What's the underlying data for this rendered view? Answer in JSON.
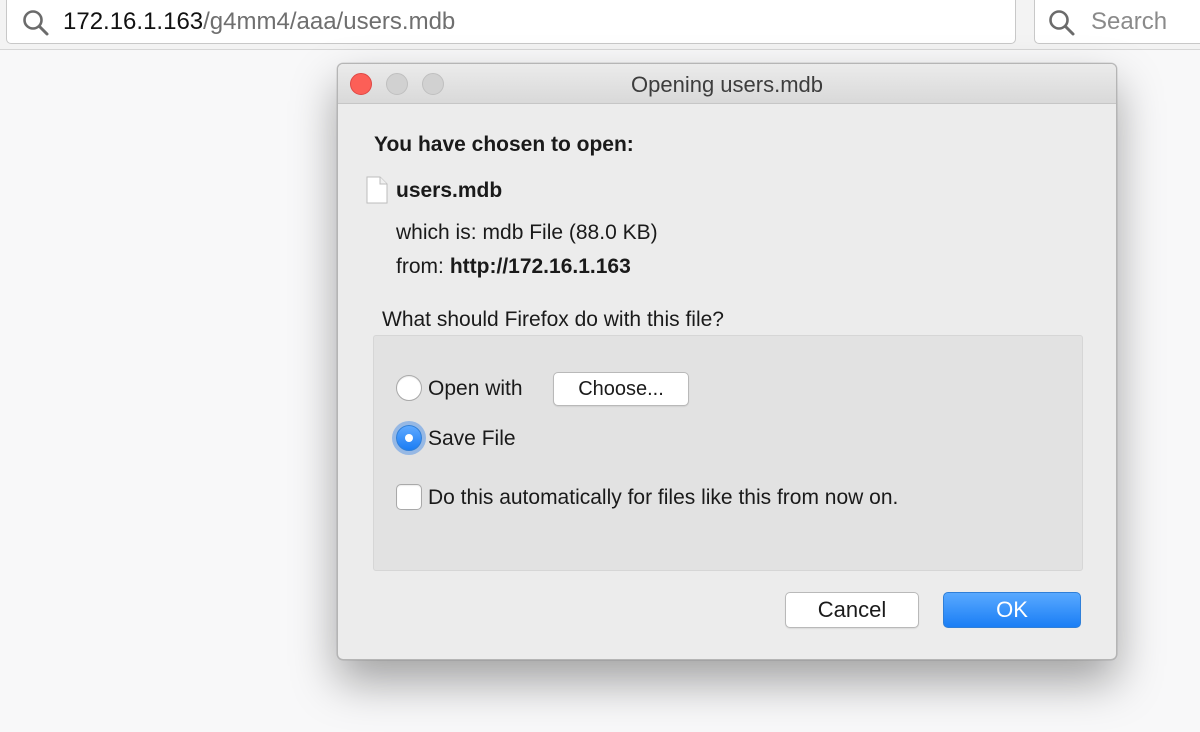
{
  "browser": {
    "url_host": "172.16.1.163",
    "url_path": "/g4mm4/aaa/users.mdb",
    "search_placeholder": "Search"
  },
  "dialog": {
    "title": "Opening users.mdb",
    "heading": "You have chosen to open:",
    "file_name": "users.mdb",
    "which_is_label": "which is:",
    "which_is_value": "mdb File (88.0 KB)",
    "from_label": "from:",
    "from_value": "http://172.16.1.163",
    "question": "What should Firefox do with this file?",
    "options": {
      "open_with_label": "Open with",
      "choose_label": "Choose...",
      "save_file_label": "Save File",
      "auto_label": "Do this automatically for files like this from now on."
    },
    "selected_option": "save_file",
    "auto_checked": false,
    "cancel_label": "Cancel",
    "ok_label": "OK"
  },
  "icons": {
    "url_icon": "search-icon",
    "search_icon": "search-icon",
    "file_icon": "document-icon"
  },
  "colors": {
    "accent": "#1b7df4",
    "close_light": "#fc5f57"
  }
}
